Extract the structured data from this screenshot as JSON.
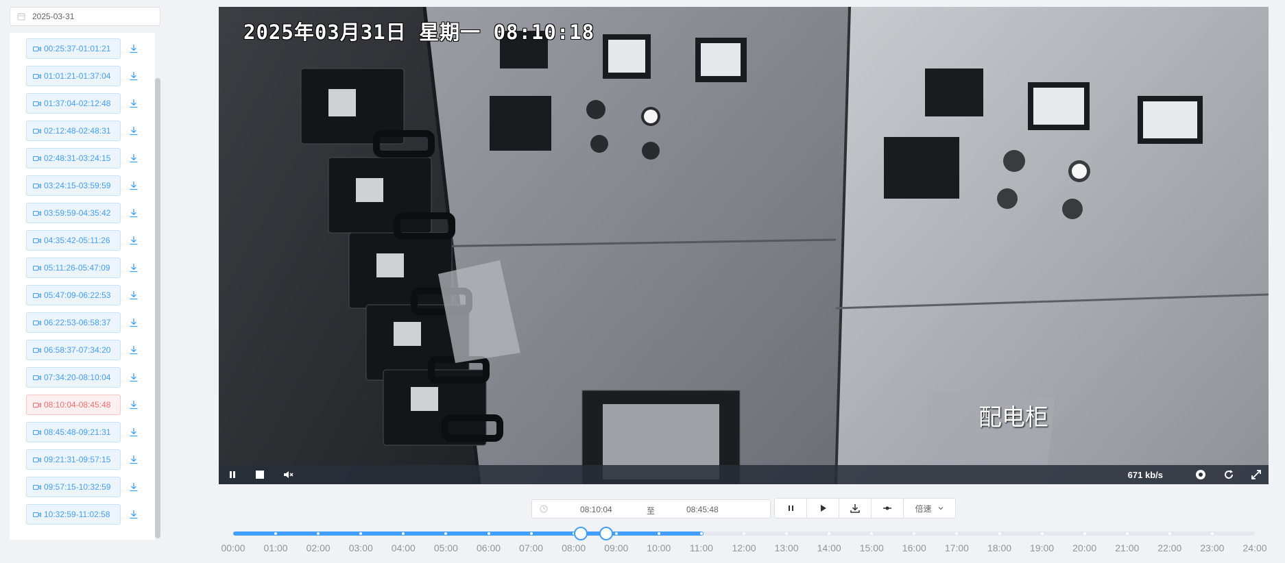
{
  "sidebar": {
    "date_value": "2025-03-31",
    "clips": [
      {
        "label": "00:25:37-01:01:21",
        "active": false
      },
      {
        "label": "01:01:21-01:37:04",
        "active": false
      },
      {
        "label": "01:37:04-02:12:48",
        "active": false
      },
      {
        "label": "02:12:48-02:48:31",
        "active": false
      },
      {
        "label": "02:48:31-03:24:15",
        "active": false
      },
      {
        "label": "03:24:15-03:59:59",
        "active": false
      },
      {
        "label": "03:59:59-04:35:42",
        "active": false
      },
      {
        "label": "04:35:42-05:11:26",
        "active": false
      },
      {
        "label": "05:11:26-05:47:09",
        "active": false
      },
      {
        "label": "05:47:09-06:22:53",
        "active": false
      },
      {
        "label": "06:22:53-06:58:37",
        "active": false
      },
      {
        "label": "06:58:37-07:34:20",
        "active": false
      },
      {
        "label": "07:34:20-08:10:04",
        "active": false
      },
      {
        "label": "08:10:04-08:45:48",
        "active": true
      },
      {
        "label": "08:45:48-09:21:31",
        "active": false
      },
      {
        "label": "09:21:31-09:57:15",
        "active": false
      },
      {
        "label": "09:57:15-10:32:59",
        "active": false
      },
      {
        "label": "10:32:59-11:02:58",
        "active": false
      }
    ]
  },
  "video": {
    "osd_timestamp": "2025年03月31日  星期一  08:10:18",
    "camera_label": "配电柜",
    "bitrate": "671 kb/s",
    "icons": [
      "pause-icon",
      "stop-icon",
      "mute-icon",
      "record-icon",
      "refresh-icon",
      "fullscreen-icon"
    ]
  },
  "controls": {
    "range_start": "08:10:04",
    "range_sep": "至",
    "range_end": "08:45:48",
    "speed_label": "倍速"
  },
  "timeline": {
    "labels": [
      "00:00",
      "01:00",
      "02:00",
      "03:00",
      "04:00",
      "05:00",
      "06:00",
      "07:00",
      "08:00",
      "09:00",
      "10:00",
      "11:00",
      "12:00",
      "13:00",
      "14:00",
      "15:00",
      "16:00",
      "17:00",
      "18:00",
      "19:00",
      "20:00",
      "21:00",
      "22:00",
      "23:00",
      "24:00"
    ],
    "recorded_hours": [
      0,
      11.05
    ],
    "selection_hours": [
      8.168,
      8.763
    ]
  },
  "colors": {
    "accent": "#409eff",
    "active_clip": "#f56c6c"
  }
}
